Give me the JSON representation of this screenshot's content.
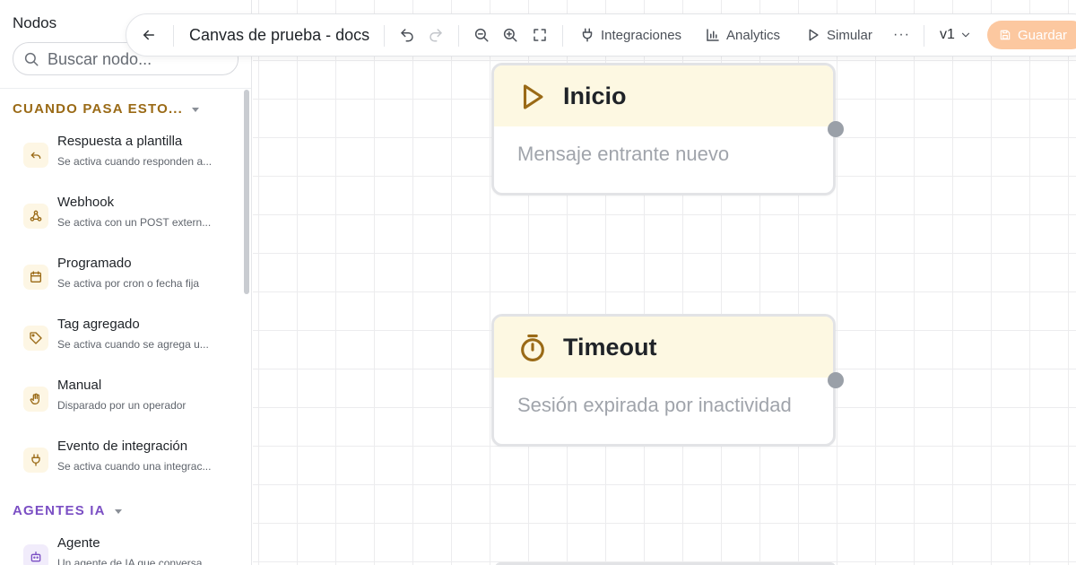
{
  "sidebar": {
    "title": "Nodos",
    "search_placeholder": "Buscar nodo...",
    "sections": [
      {
        "label": "CUANDO PASA ESTO...",
        "color": "#9a6a16",
        "items": [
          {
            "name": "Respuesta a plantilla",
            "desc": "Se activa cuando responden a...",
            "icon": "reply-icon"
          },
          {
            "name": "Webhook",
            "desc": "Se activa con un POST extern...",
            "icon": "webhook-icon"
          },
          {
            "name": "Programado",
            "desc": "Se activa por cron o fecha fija",
            "icon": "calendar-icon"
          },
          {
            "name": "Tag agregado",
            "desc": "Se activa cuando se agrega u...",
            "icon": "tag-icon"
          },
          {
            "name": "Manual",
            "desc": "Disparado por un operador",
            "icon": "hand-icon"
          },
          {
            "name": "Evento de integración",
            "desc": "Se activa cuando una integrac...",
            "icon": "plug-icon"
          }
        ]
      },
      {
        "label": "AGENTES IA",
        "color": "#7b4fc4",
        "items": [
          {
            "name": "Agente",
            "desc": "Un agente de IA que conversa...",
            "icon": "bot-icon"
          }
        ]
      }
    ]
  },
  "toolbar": {
    "title": "Canvas de prueba - docs",
    "integrations_label": "Integraciones",
    "analytics_label": "Analytics",
    "simulate_label": "Simular",
    "more_label": "···",
    "version_label": "v1",
    "save_label": "Guardar",
    "save_color": "#fcc8a0"
  },
  "canvas": {
    "nodes": [
      {
        "title": "Inicio",
        "subtitle": "Mensaje entrante nuevo",
        "icon": "play-icon"
      },
      {
        "title": "Timeout",
        "subtitle": "Sesión expirada por inactividad",
        "icon": "stopwatch-icon"
      }
    ]
  },
  "colors": {
    "accent_trigger": "#9a6a16",
    "accent_agent": "#7b4fc4",
    "node_header_bg": "#fdf8e2"
  }
}
